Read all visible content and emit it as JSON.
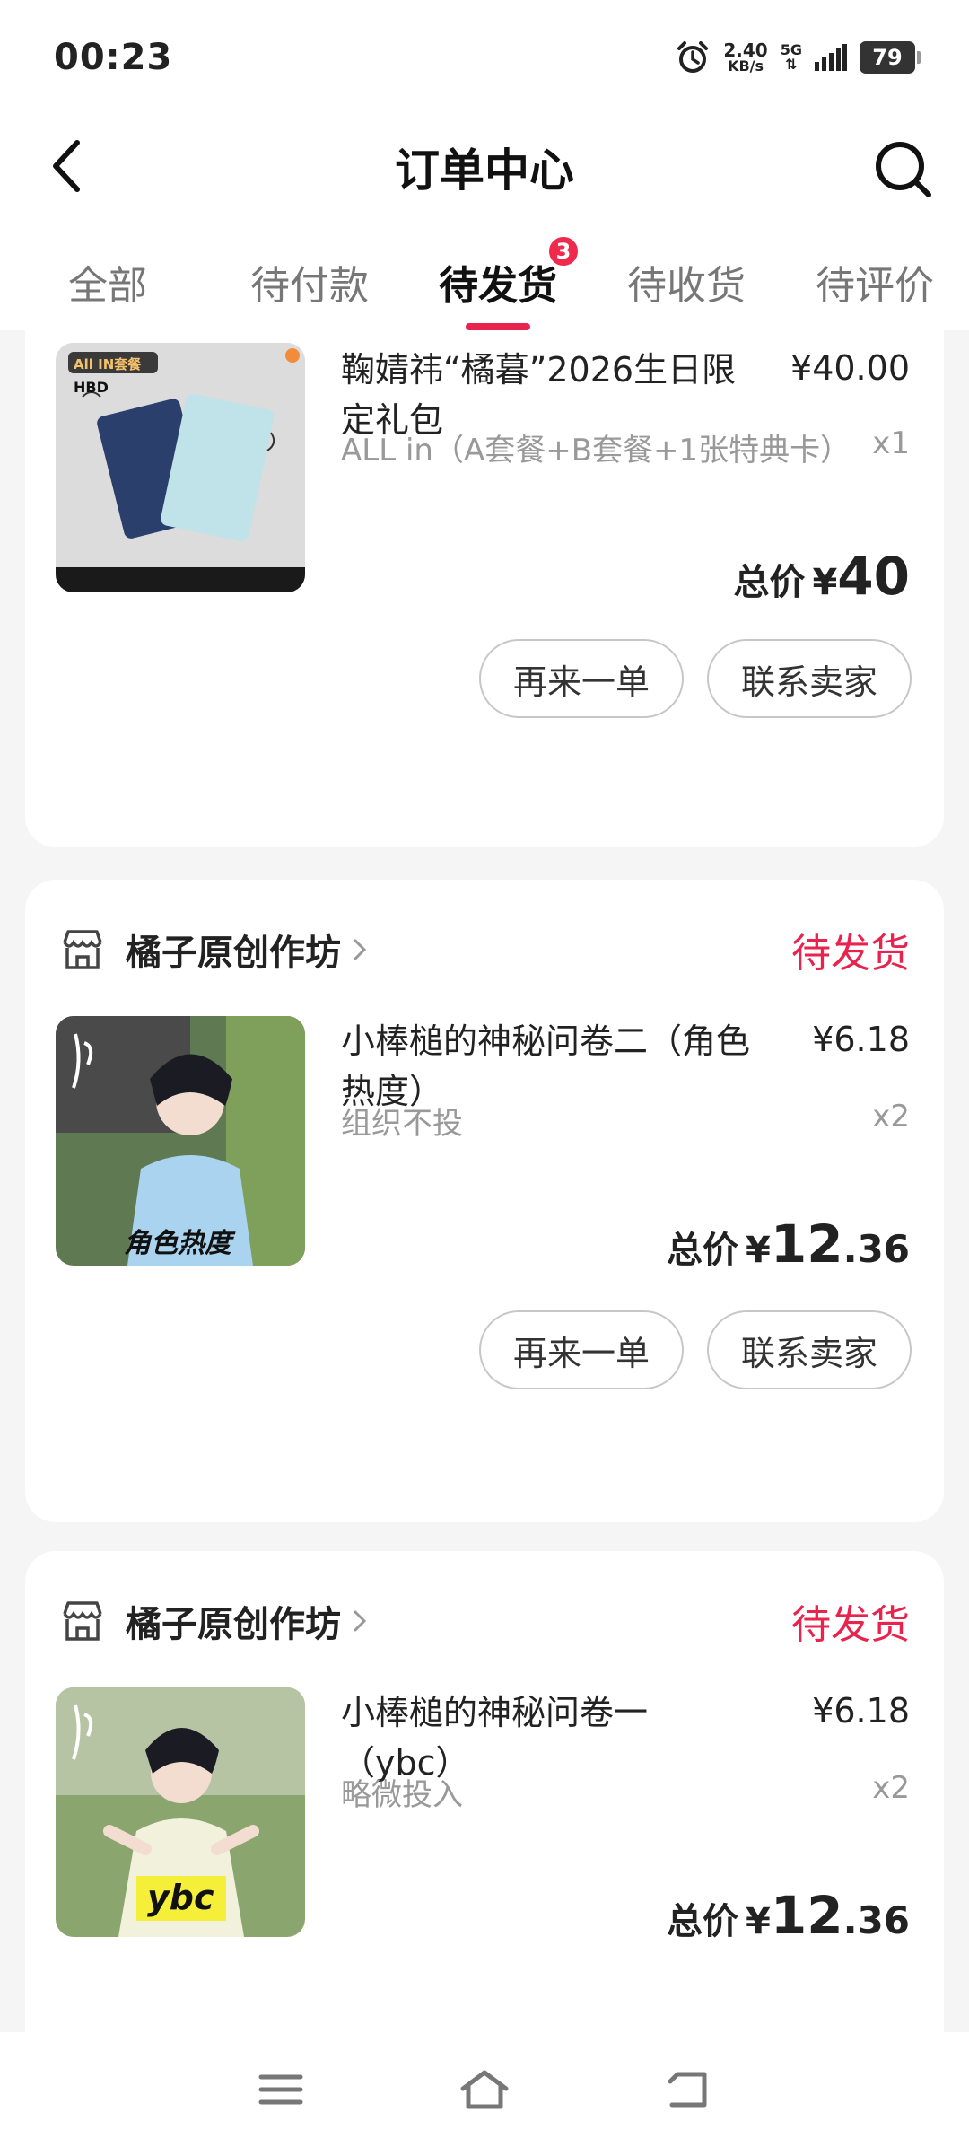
{
  "status_bar": {
    "time": "00:23",
    "net_speed_value": "2.40",
    "net_speed_unit": "KB/s",
    "network": "5G",
    "battery": "79"
  },
  "header": {
    "title": "订单中心"
  },
  "tabs": [
    {
      "label": "全部"
    },
    {
      "label": "待付款"
    },
    {
      "label": "待发货",
      "badge": "3"
    },
    {
      "label": "待收货"
    },
    {
      "label": "待评价"
    }
  ],
  "orders": [
    {
      "product_name": "鞠婧祎“橘暮”2026生日限定礼包",
      "price": "¥40.00",
      "spec": "ALL in（A套餐+B套餐+1张特典卡）",
      "qty": "x1",
      "total_label": "总价",
      "total_currency": "¥",
      "total_int": "40",
      "total_dec": "",
      "thumb_text_top": "All IN套餐",
      "thumb_text_hbd": "HBD",
      "reorder_label": "再来一单",
      "contact_label": "联系卖家"
    },
    {
      "shop_name": "橘子原创作坊",
      "status": "待发货",
      "product_name": "小棒槌的神秘问卷二（角色热度）",
      "price": "¥6.18",
      "spec": "组织不投",
      "qty": "x2",
      "total_label": "总价",
      "total_currency": "¥",
      "total_int": "12",
      "total_dec": ".36",
      "thumb_caption": "角色热度",
      "reorder_label": "再来一单",
      "contact_label": "联系卖家"
    },
    {
      "shop_name": "橘子原创作坊",
      "status": "待发货",
      "product_name": "小棒槌的神秘问卷一（ybc）",
      "price": "¥6.18",
      "spec": "略微投入",
      "qty": "x2",
      "total_label": "总价",
      "total_currency": "¥",
      "total_int": "12",
      "total_dec": ".36",
      "thumb_caption": "ybc"
    }
  ],
  "colors": {
    "accent": "#e8234e",
    "background": "#f5f5f5"
  }
}
